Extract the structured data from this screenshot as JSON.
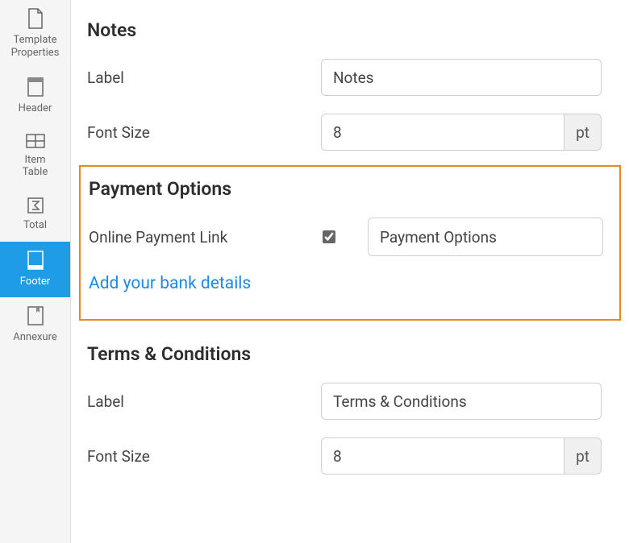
{
  "sidebar": {
    "items": [
      {
        "label": "Template\nProperties"
      },
      {
        "label": "Header"
      },
      {
        "label": "Item\nTable"
      },
      {
        "label": "Total"
      },
      {
        "label": "Footer"
      },
      {
        "label": "Annexure"
      }
    ]
  },
  "notes": {
    "title": "Notes",
    "label_caption": "Label",
    "label_value": "Notes",
    "fontsize_caption": "Font Size",
    "fontsize_value": "8",
    "fontsize_unit": "pt"
  },
  "payment": {
    "title": "Payment Options",
    "online_label": "Online Payment Link",
    "online_value": "Payment Options",
    "bank_link": "Add your bank details"
  },
  "terms": {
    "title": "Terms & Conditions",
    "label_caption": "Label",
    "label_value": "Terms & Conditions",
    "fontsize_caption": "Font Size",
    "fontsize_value": "8",
    "fontsize_unit": "pt"
  }
}
